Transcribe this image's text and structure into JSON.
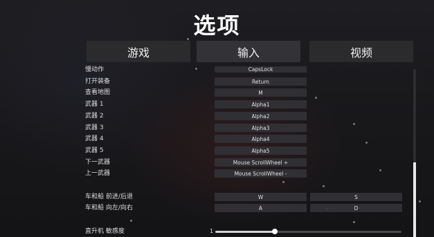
{
  "title": "选项",
  "tabs": [
    {
      "label": "游戏"
    },
    {
      "label": "输入"
    },
    {
      "label": "视频"
    }
  ],
  "bindings": [
    {
      "label": "慢动作",
      "key": "CapsLock"
    },
    {
      "label": "打开装备",
      "key": "Return"
    },
    {
      "label": "查看地图",
      "key": "M"
    },
    {
      "label": "武器 1",
      "key": "Alpha1"
    },
    {
      "label": "武器 2",
      "key": "Alpha2"
    },
    {
      "label": "武器 3",
      "key": "Alpha3"
    },
    {
      "label": "武器 4",
      "key": "Alpha4"
    },
    {
      "label": "武器 5",
      "key": "Alpha5"
    },
    {
      "label": "下一武器",
      "key": "Mouse ScrollWheel +"
    },
    {
      "label": "上一武器",
      "key": "Mouse ScrollWheel -"
    }
  ],
  "vehicle_bindings": [
    {
      "label": "车和船 前进/后退",
      "key1": "W",
      "key2": "S"
    },
    {
      "label": "车和船 向左/向右",
      "key1": "A",
      "key2": "D"
    }
  ],
  "helicopter_sensitivity": {
    "label": "直升机 敏感度",
    "value_text": "1",
    "fraction": 0.32
  },
  "scrollbar": {
    "position_fraction": 0.56
  }
}
